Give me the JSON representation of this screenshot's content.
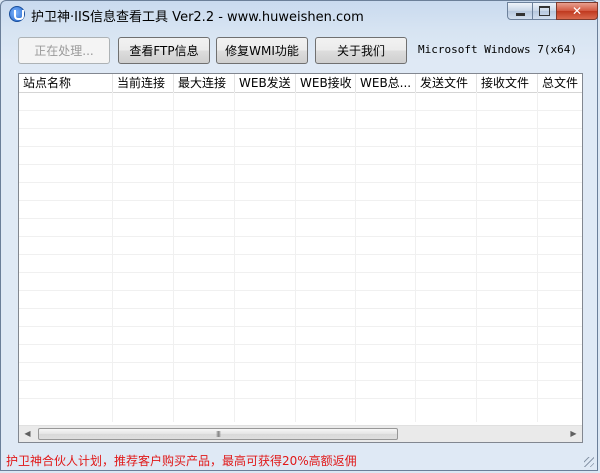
{
  "window": {
    "title": "护卫神·IIS信息查看工具 Ver2.2 - www.huweishen.com"
  },
  "toolbar": {
    "buttons": [
      {
        "label": "正在处理...",
        "enabled": false
      },
      {
        "label": "查看FTP信息",
        "enabled": true
      },
      {
        "label": "修复WMI功能",
        "enabled": true
      },
      {
        "label": "关于我们",
        "enabled": true
      }
    ],
    "os_info": "Microsoft Windows 7(x64)"
  },
  "table": {
    "columns": [
      "站点名称",
      "当前连接",
      "最大连接",
      "WEB发送",
      "WEB接收",
      "WEB总...",
      "发送文件",
      "接收文件",
      "总文件"
    ],
    "rows": []
  },
  "scrollbar": {
    "grip": "III"
  },
  "status": {
    "text": "护卫神合伙人计划，推荐客户购买产品，最高可获得20%高额返佣"
  },
  "icons": {
    "app": "shield-icon",
    "minimize": "minimize-icon",
    "maximize": "maximize-icon",
    "close": "close-icon",
    "scroll_left": "arrow-left-icon",
    "scroll_right": "arrow-right-icon"
  }
}
